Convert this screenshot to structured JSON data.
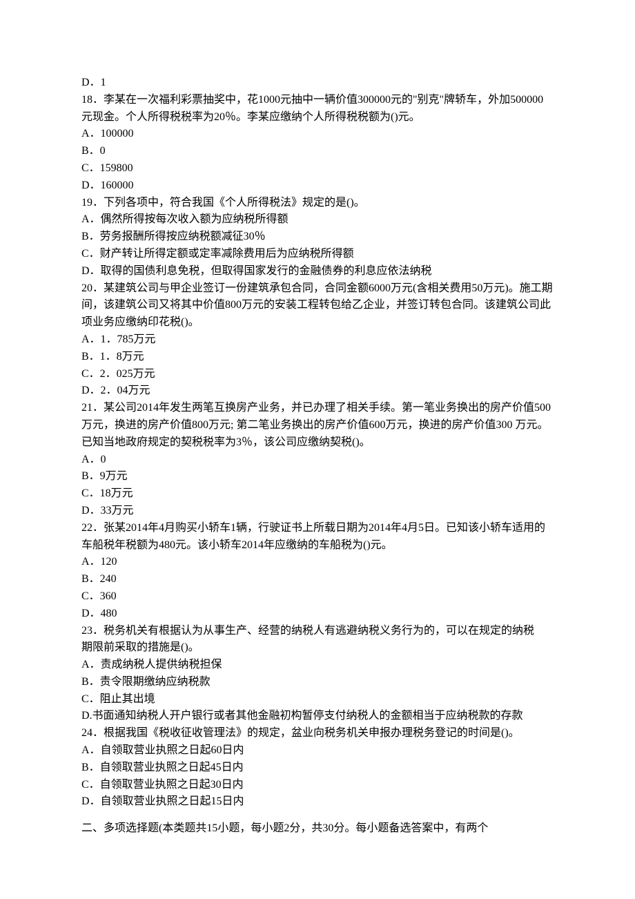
{
  "q17_option_d": "D．1",
  "q18": {
    "stem": "18．李某在一次福利彩票抽奖中，花1000元抽中一辆价值300000元的\"别克\"牌轿车，外加500000元现金。个人所得税税率为20％。李某应缴纳个人所得税税额为()元。",
    "a": "A．100000",
    "b": "B．0",
    "c": "C．159800",
    "d": "D．160000"
  },
  "q19": {
    "stem": "19．下列各项中，符合我国《个人所得税法》规定的是()。",
    "a": "A．偶然所得按每次收入额为应纳税所得额",
    "b": "B．劳务报酬所得按应纳税额减征30％",
    "c": "C．财产转让所得定额或定率减除费用后为应纳税所得额",
    "d": "D．取得的国债利息免税，但取得国家发行的金融债券的利息应依法纳税"
  },
  "q20": {
    "stem": "20．某建筑公司与甲企业签订一份建筑承包合同，合同金额6000万元(含相关费用50万元)。施工期间，该建筑公司又将其中价值800万元的安装工程转包给乙企业，并签订转包合同。该建筑公司此项业务应缴纳印花税()。",
    "a": "A．1．785万元",
    "b": "B．1．8万元",
    "c": "C．2．025万元",
    "d": "D．2．04万元"
  },
  "q21": {
    "stem": "21．某公司2014年发生两笔互换房产业务，并已办理了相关手续。第一笔业务换出的房产价值500万元，换进的房产价值800万元; 第二笔业务换出的房产价值600万元，换进的房产价值300 万元。已知当地政府规定的契税税率为3％，该公司应缴纳契税()。",
    "a": "A．0",
    "b": "B．9万元",
    "c": "C．18万元",
    "d": "D．33万元"
  },
  "q22": {
    "stem": "22．张某2014年4月购买小轿车1辆，行驶证书上所载日期为2014年4月5日。已知该小轿车适用的车船税年税额为480元。该小轿车2014年应缴纳的车船税为()元。",
    "a": "A．120",
    "b": "B．240",
    "c": "C．360",
    "d": "D．480"
  },
  "q23": {
    "stem1": "23．税务机关有根据认为从事生产、经营的纳税人有逃避纳税义务行为的，可以在规定的纳税",
    "stem2": "期限前采取的措施是()。",
    "a": "A．责成纳税人提供纳税担保",
    "b": "B．责令限期缴纳应纳税款",
    "c": "C．阻止其出境",
    "d": "D.书面通知纳税人开户银行或者其他金融初构暂停支付纳税人的金额相当于应纳税款的存款"
  },
  "q24": {
    "stem": "24．根据我国《税收征收管理法》的规定，盆业向税务机关申报办理税务登记的时间是()。",
    "a": "A．自领取营业执照之日起60日内",
    "b": "B．自领取营业执照之日起45日内",
    "c": "C．自领取营业执照之日起30日内",
    "d": "D．自领取营业执照之日起15日内"
  },
  "section2": "二、多项选择题(本类题共15小题，每小题2分，共30分。每小题备选答案中，有两个"
}
